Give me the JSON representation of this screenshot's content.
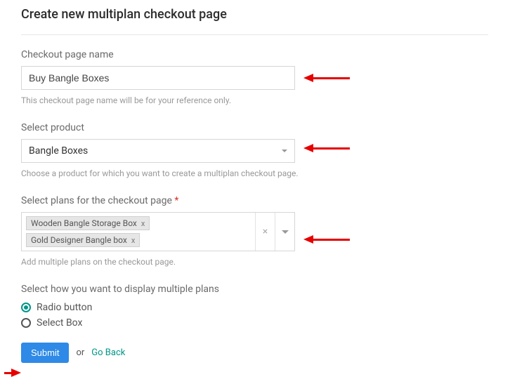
{
  "page_title": "Create new multiplan checkout page",
  "checkout_name": {
    "label": "Checkout page name",
    "value": "Buy Bangle Boxes",
    "helper": "This checkout page name will be for your reference only."
  },
  "product": {
    "label": "Select product",
    "value": "Bangle Boxes",
    "helper": "Choose a product for which you want to create a multiplan checkout page."
  },
  "plans": {
    "label": "Select plans for the checkout page",
    "required": "*",
    "tags": [
      "Wooden Bangle Storage Box",
      "Gold Designer Bangle box"
    ],
    "helper": "Add multiple plans on the checkout page."
  },
  "display_mode": {
    "label": "Select how you want to display multiple plans",
    "options": [
      "Radio button",
      "Select Box"
    ],
    "selected": "Radio button"
  },
  "actions": {
    "submit": "Submit",
    "or": "or",
    "back": "Go Back"
  }
}
